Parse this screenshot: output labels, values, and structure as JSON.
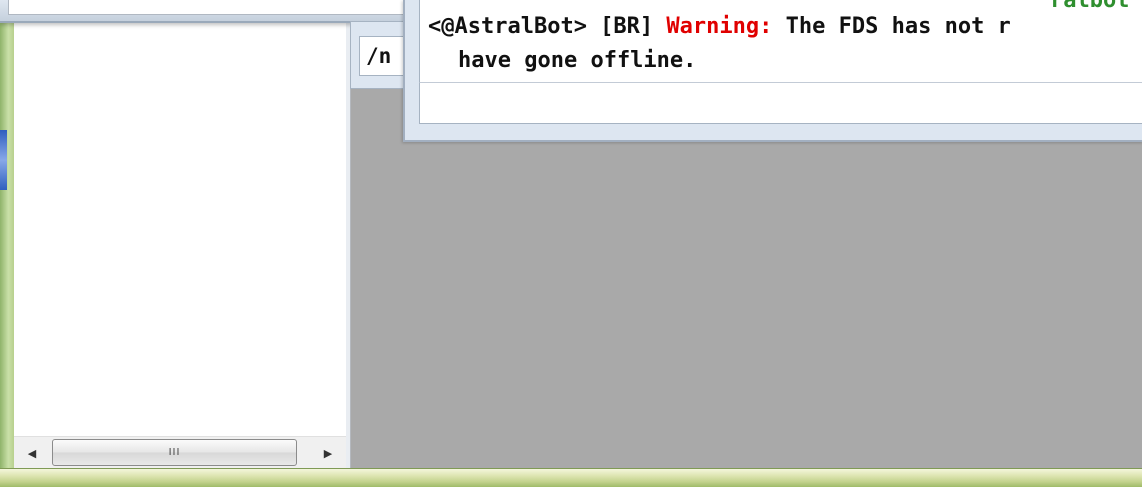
{
  "chat": {
    "line1_prefix": "<@AstralBot> [BR] ",
    "line1_warning": "Warning:",
    "line1_rest": " The FDS has not r",
    "line2": "have gone offline."
  },
  "back_window": {
    "input_fragment": "/n"
  },
  "top_right_fragment": "ralbot",
  "scrollbar": {
    "left_arrow": "◀",
    "right_arrow": "▶",
    "grip": "III"
  },
  "colors": {
    "warning": "#e00000",
    "workspace": "#a9a9a9",
    "frame_green": "#b8d08e"
  }
}
